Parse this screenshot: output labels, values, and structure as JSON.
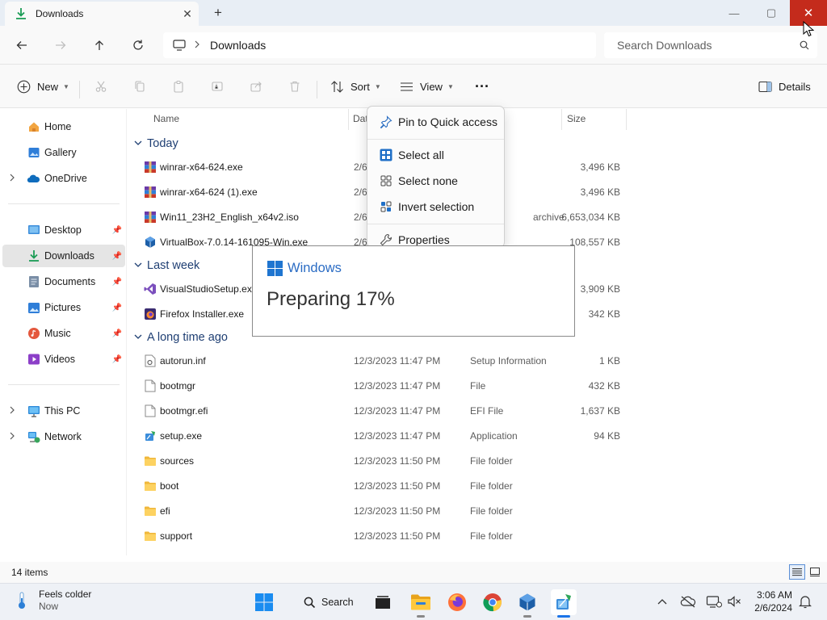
{
  "window": {
    "tab_title": "Downloads",
    "tab_close": "✕",
    "new_tab": "+",
    "min": "—",
    "max": "▢",
    "close": "✕"
  },
  "addressbar": {
    "breadcrumb": "Downloads",
    "search_placeholder": "Search Downloads"
  },
  "commandbar": {
    "new_label": "New",
    "sort_label": "Sort",
    "view_label": "View",
    "more_label": "···",
    "details_label": "Details"
  },
  "navpane": {
    "items": [
      {
        "label": "Home",
        "icon": "home-icon"
      },
      {
        "label": "Gallery",
        "icon": "gallery-icon"
      },
      {
        "label": "OneDrive",
        "icon": "onedrive-icon"
      },
      {
        "label": "Desktop",
        "icon": "desktop-icon"
      },
      {
        "label": "Downloads",
        "icon": "downloads-icon"
      },
      {
        "label": "Documents",
        "icon": "documents-icon"
      },
      {
        "label": "Pictures",
        "icon": "pictures-icon"
      },
      {
        "label": "Music",
        "icon": "music-icon"
      },
      {
        "label": "Videos",
        "icon": "videos-icon"
      },
      {
        "label": "This PC",
        "icon": "this-pc-icon"
      },
      {
        "label": "Network",
        "icon": "network-icon"
      }
    ]
  },
  "columns": {
    "name": "Name",
    "date": "Dat",
    "size": "Size"
  },
  "groups": {
    "today": "Today",
    "last_week": "Last week",
    "long_ago": "A long time ago"
  },
  "files": {
    "today": [
      {
        "name": "winrar-x64-624.exe",
        "date": "2/6",
        "type": "ation",
        "size": "3,496 KB",
        "icon": "winrar-icon"
      },
      {
        "name": "winrar-x64-624 (1).exe",
        "date": "2/6",
        "type": "ation",
        "size": "3,496 KB",
        "icon": "winrar-icon"
      },
      {
        "name": "Win11_23H2_English_x64v2.iso",
        "date": "2/6",
        "type": "archive",
        "size": "6,653,034 KB",
        "icon": "winrar-icon"
      },
      {
        "name": "VirtualBox-7.0.14-161095-Win.exe",
        "date": "2/6",
        "type": "",
        "size": "108,557 KB",
        "icon": "virtualbox-icon"
      }
    ],
    "last_week": [
      {
        "name": "VisualStudioSetup.exe",
        "date": "",
        "type": "",
        "size": "3,909 KB",
        "icon": "visual-studio-icon"
      },
      {
        "name": "Firefox Installer.exe",
        "date": "",
        "type": "",
        "size": "342 KB",
        "icon": "firefox-icon"
      }
    ],
    "long_ago": [
      {
        "name": "autorun.inf",
        "date": "12/3/2023 11:47 PM",
        "type": "Setup Information",
        "size": "1 KB",
        "icon": "setup-info-icon"
      },
      {
        "name": "bootmgr",
        "date": "12/3/2023 11:47 PM",
        "type": "File",
        "size": "432 KB",
        "icon": "file-icon"
      },
      {
        "name": "bootmgr.efi",
        "date": "12/3/2023 11:47 PM",
        "type": "EFI File",
        "size": "1,637 KB",
        "icon": "file-icon"
      },
      {
        "name": "setup.exe",
        "date": "12/3/2023 11:47 PM",
        "type": "Application",
        "size": "94 KB",
        "icon": "setup-app-icon"
      },
      {
        "name": "sources",
        "date": "12/3/2023 11:50 PM",
        "type": "File folder",
        "size": "",
        "icon": "folder-icon"
      },
      {
        "name": "boot",
        "date": "12/3/2023 11:50 PM",
        "type": "File folder",
        "size": "",
        "icon": "folder-icon"
      },
      {
        "name": "efi",
        "date": "12/3/2023 11:50 PM",
        "type": "File folder",
        "size": "",
        "icon": "folder-icon"
      },
      {
        "name": "support",
        "date": "12/3/2023 11:50 PM",
        "type": "File folder",
        "size": "",
        "icon": "folder-icon"
      }
    ]
  },
  "context_menu": {
    "pin": "Pin to Quick access",
    "select_all": "Select all",
    "select_none": "Select none",
    "invert": "Invert selection",
    "properties": "Properties"
  },
  "setup_dialog": {
    "brand": "Windows",
    "status": "Preparing 17%",
    "progress_percent": 17
  },
  "statusbar": {
    "item_count": "14 items"
  },
  "taskbar": {
    "weather_title": "Feels colder",
    "weather_sub": "Now",
    "search_label": "Search",
    "time": "3:06 AM",
    "date": "2/6/2024",
    "apps": [
      "start-icon",
      "search-icon",
      "task-view-icon",
      "file-explorer-icon",
      "firefox-icon",
      "chrome-icon",
      "virtualbox-icon",
      "windows-setup-icon"
    ]
  },
  "colors": {
    "close_red": "#c42b1c",
    "accent_blue": "#1f75d0",
    "group_header": "#1f3f73",
    "selected_nav": "#e5e5e5"
  }
}
